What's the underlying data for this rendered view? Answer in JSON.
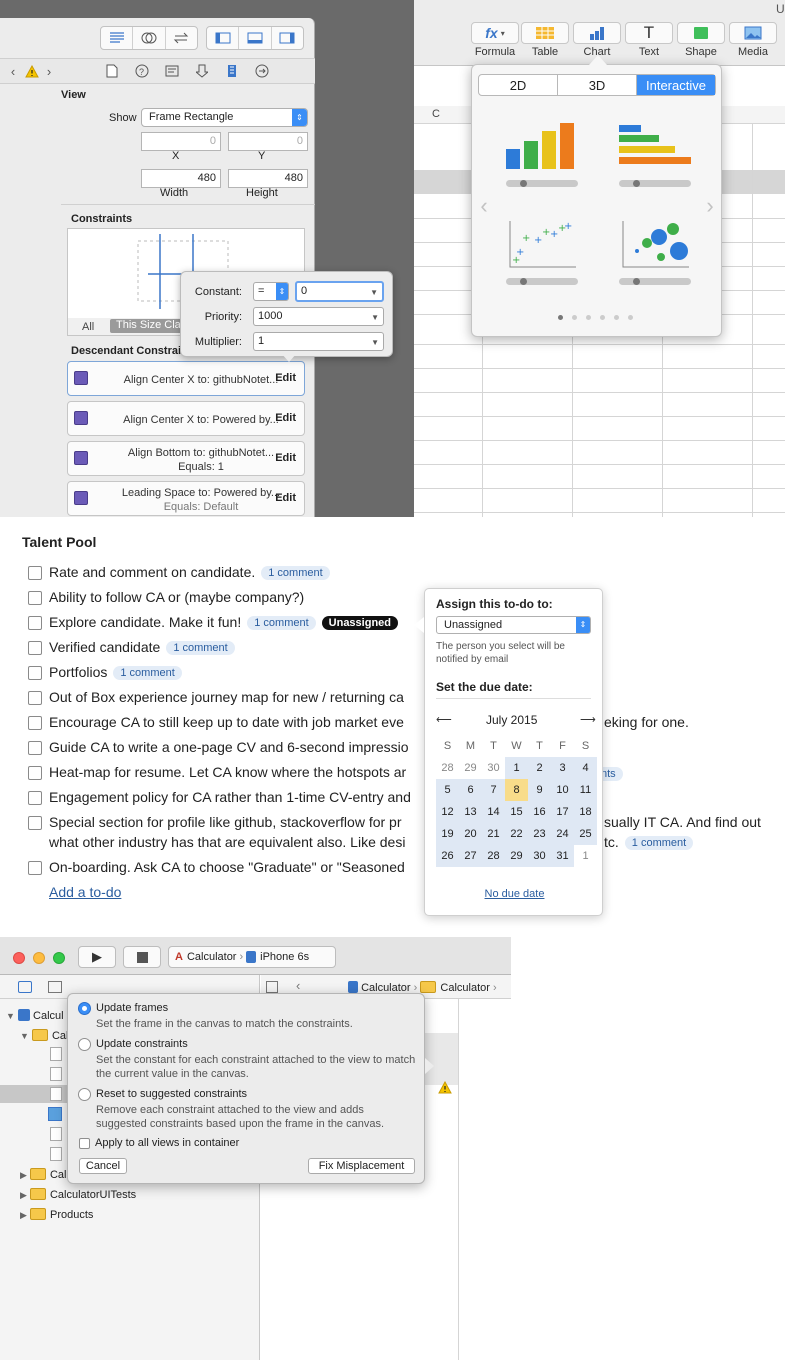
{
  "inspector": {
    "view_header": "View",
    "show_label": "Show",
    "show_value": "Frame Rectangle",
    "x_value": "0",
    "y_value": "0",
    "x_label": "X",
    "y_label": "Y",
    "width_value": "480",
    "height_value": "480",
    "width_label": "Width",
    "height_label": "Height",
    "constraints_header": "Constraints",
    "all_tab": "All",
    "size_class_tab": "This Size Class",
    "descendant_header": "Descendant Constraints",
    "constraints": [
      {
        "line1": "Align Center X to: githubNotet...",
        "line2": "",
        "edit": "Edit"
      },
      {
        "line1": "Align Center X to: Powered by...",
        "line2": "",
        "edit": "Edit"
      },
      {
        "line1": "Align Bottom to: githubNotet...",
        "line2": "Equals: 1",
        "edit": "Edit"
      },
      {
        "line1": "Leading Space to: Powered by...",
        "line2": "Equals: Default",
        "edit": "Edit"
      }
    ]
  },
  "constant_popover": {
    "constant_label": "Constant:",
    "relation": "=",
    "constant_value": "0",
    "priority_label": "Priority:",
    "priority_value": "1000",
    "multiplier_label": "Multiplier:",
    "multiplier_value": "1"
  },
  "numbers": {
    "toolbar": [
      "Formula",
      "Table",
      "Chart",
      "Text",
      "Shape",
      "Media"
    ],
    "column_c": "C",
    "title_fragment": "U",
    "chart_tabs": [
      "2D",
      "3D",
      "Interactive"
    ],
    "selected_tab": "Interactive"
  },
  "talent": {
    "title": "Talent Pool",
    "todos": [
      {
        "text": "Rate and comment on candidate.",
        "comment": "1 comment",
        "badge": ""
      },
      {
        "text": "Ability to follow CA or (maybe company?)",
        "comment": "",
        "badge": ""
      },
      {
        "text": "Explore candidate. Make it fun!",
        "comment": "1 comment",
        "badge": "Unassigned"
      },
      {
        "text": "Verified candidate",
        "comment": "1 comment",
        "badge": ""
      },
      {
        "text": "Portfolios",
        "comment": "1 comment",
        "badge": ""
      },
      {
        "text": "Out of Box experience journey map for new / returning ca",
        "comment": "",
        "badge": ""
      },
      {
        "text": "Encourage CA to still keep up to date with job market eve",
        "tail": "eking for one.",
        "comment": "",
        "badge": ""
      },
      {
        "text": "Guide CA to write a one-page CV and 6-second impressio",
        "comment": "",
        "badge": ""
      },
      {
        "text": "Heat-map for resume. Let CA know where the hotspots ar",
        "tail": "nts",
        "comment": "",
        "badge": ""
      },
      {
        "text": "Engagement policy for CA rather than 1-time CV-entry and",
        "comment": "",
        "badge": ""
      },
      {
        "text": "Special section for profile like github, stackoverflow for pr",
        "tail": "sually IT CA. And find out",
        "line2": "what other industry has that are equivalent also. Like desi",
        "tail2": "tc.",
        "comment": "1 comment",
        "badge": ""
      },
      {
        "text": "On-boarding. Ask CA to choose \"Graduate\" or \"Seasoned",
        "comment": "",
        "badge": ""
      }
    ],
    "add_link": "Add a to-do",
    "assign": {
      "title": "Assign this to-do to:",
      "select_value": "Unassigned",
      "note": "The person you select will be notified by email",
      "due_title": "Set the due date:",
      "month": "July 2015",
      "weekdays": [
        "S",
        "M",
        "T",
        "W",
        "T",
        "F",
        "S"
      ],
      "weeks": [
        [
          "28",
          "29",
          "30",
          "1",
          "2",
          "3",
          "4"
        ],
        [
          "5",
          "6",
          "7",
          "8",
          "9",
          "10",
          "11"
        ],
        [
          "12",
          "13",
          "14",
          "15",
          "16",
          "17",
          "18"
        ],
        [
          "19",
          "20",
          "21",
          "22",
          "23",
          "24",
          "25"
        ],
        [
          "26",
          "27",
          "28",
          "29",
          "30",
          "31",
          "1"
        ]
      ],
      "today": "8",
      "no_due": "No due date"
    }
  },
  "xcode": {
    "scheme": "Calculator",
    "device": "iPhone 6s",
    "jump_bar": [
      "Calculator",
      "Calculator"
    ],
    "tree": [
      "Calcul",
      "Calc",
      "Calc",
      "CalculatorUITests",
      "Products"
    ],
    "popover": {
      "opt1": "Update frames",
      "opt1_desc": "Set the frame in the canvas to match the constraints.",
      "opt2": "Update constraints",
      "opt2_desc": "Set the constant for each constraint attached to the view to match the current value in the canvas.",
      "opt3": "Reset to suggested constraints",
      "opt3_desc": "Remove each constraint attached to the view and adds suggested constraints based upon the frame in the canvas.",
      "apply_all": "Apply to all views in container",
      "cancel": "Cancel",
      "fix": "Fix Misplacement"
    }
  },
  "colors": {
    "accent": "#3a8ef6",
    "today": "#f8dc8a",
    "cal_bg": "#dfe8f4"
  }
}
